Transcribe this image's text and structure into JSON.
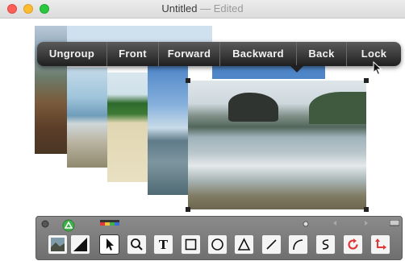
{
  "window": {
    "title": "Untitled",
    "separator": " — ",
    "status": "Edited"
  },
  "context_menu": {
    "items": [
      "Ungroup",
      "Front",
      "Forward",
      "Backward",
      "Back",
      "Lock"
    ]
  },
  "toolbar": {
    "tools": [
      {
        "name": "select-tool",
        "icon": "arrow-icon"
      },
      {
        "name": "zoom-tool",
        "icon": "magnifier-icon"
      },
      {
        "name": "text-tool",
        "icon": "text-icon",
        "label": "T"
      },
      {
        "name": "rectangle-tool",
        "icon": "rectangle-icon"
      },
      {
        "name": "ellipse-tool",
        "icon": "circle-icon"
      },
      {
        "name": "triangle-tool",
        "icon": "triangle-icon"
      },
      {
        "name": "line-tool",
        "icon": "line-icon"
      },
      {
        "name": "arc-tool",
        "icon": "arc-icon"
      },
      {
        "name": "curve-tool",
        "icon": "curve-icon"
      },
      {
        "name": "rotate-tool",
        "icon": "rotate-icon"
      },
      {
        "name": "transform-tool",
        "icon": "transform-icon"
      }
    ]
  },
  "colors": {
    "accent_red": "#e0373a",
    "accent_green": "#3fb04a"
  }
}
